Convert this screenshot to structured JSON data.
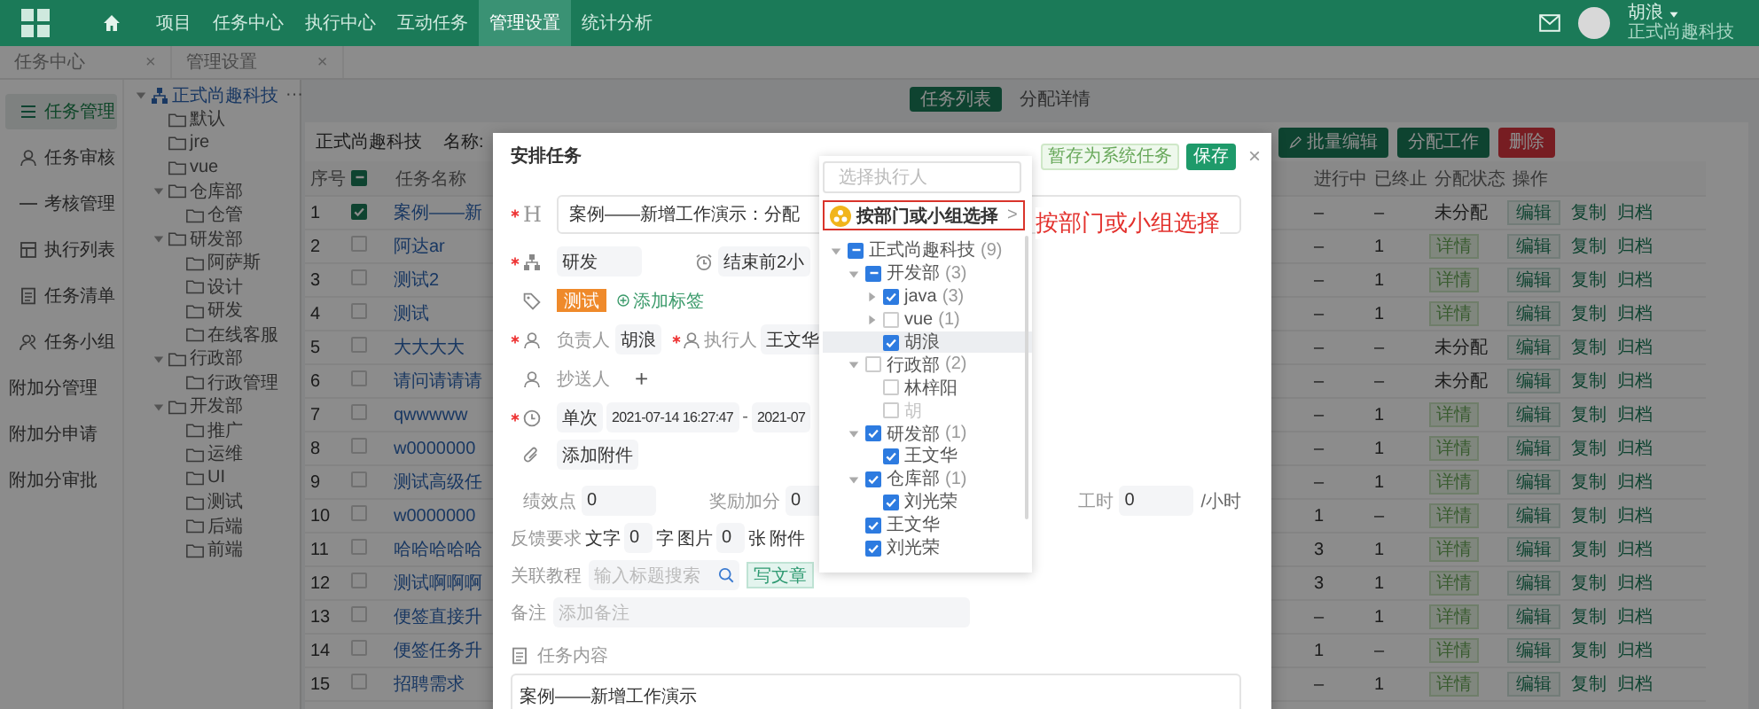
{
  "top_nav": {
    "items": [
      {
        "label": "项目",
        "selected": false
      },
      {
        "label": "任务中心",
        "selected": false
      },
      {
        "label": "执行中心",
        "selected": false
      },
      {
        "label": "互动任务",
        "selected": false
      },
      {
        "label": "管理设置",
        "selected": true
      },
      {
        "label": "统计分析",
        "selected": false
      }
    ],
    "user": {
      "name": "胡浪",
      "org": "正式尚趣科技"
    }
  },
  "page_tabs": [
    {
      "label": "任务中心",
      "close": "×"
    },
    {
      "label": "管理设置",
      "close": "×"
    }
  ],
  "sidebar": {
    "items": [
      {
        "label": "任务管理",
        "selected": true
      },
      {
        "label": "任务审核",
        "selected": false
      },
      {
        "label": "考核管理",
        "selected": false
      },
      {
        "label": "执行列表",
        "selected": false
      },
      {
        "label": "任务清单",
        "selected": false
      },
      {
        "label": "任务小组",
        "selected": false
      },
      {
        "label": "附加分管理",
        "selected": false
      },
      {
        "label": "附加分申请",
        "selected": false
      },
      {
        "label": "附加分审批",
        "selected": false
      }
    ]
  },
  "org_tree": {
    "label": "正式尚趣科技",
    "more": "···",
    "expanded": true,
    "children": [
      {
        "label": "默认"
      },
      {
        "label": "jre"
      },
      {
        "label": "vue"
      },
      {
        "label": "仓库部",
        "expanded": true,
        "children": [
          {
            "label": "仓管"
          }
        ]
      },
      {
        "label": "研发部",
        "expanded": true,
        "children": [
          {
            "label": "阿萨斯"
          },
          {
            "label": "设计"
          },
          {
            "label": "研发"
          },
          {
            "label": "在线客服"
          }
        ]
      },
      {
        "label": "行政部",
        "expanded": true,
        "children": [
          {
            "label": "行政管理"
          }
        ]
      },
      {
        "label": "开发部",
        "expanded": true,
        "children": [
          {
            "label": "推广"
          },
          {
            "label": "运维"
          },
          {
            "label": "UI"
          },
          {
            "label": "测试"
          },
          {
            "label": "后端"
          },
          {
            "label": "前端"
          }
        ]
      }
    ]
  },
  "main": {
    "view_tabs": [
      {
        "label": "任务列表",
        "selected": true
      },
      {
        "label": "分配详情",
        "selected": false
      }
    ],
    "org": "正式尚趣科技",
    "name_label": "名称:",
    "buttons": [
      {
        "label": "批量编辑",
        "kind": "primary"
      },
      {
        "label": "分配工作",
        "kind": "primary"
      },
      {
        "label": "删除",
        "kind": "danger"
      }
    ],
    "table": {
      "columns": [
        "序号",
        "任务名称",
        "进行中",
        "已终止",
        "分配状态",
        "操作"
      ],
      "header_checked": false,
      "header_indeterminate": true,
      "rows": [
        {
          "no": "1",
          "selected": true,
          "name": "案例——新",
          "in_progress": "–",
          "terminated": "–",
          "status": {
            "kind": "text",
            "label": "未分配"
          },
          "edit": "编辑",
          "copy": "复制",
          "archive": "归档"
        },
        {
          "no": "2",
          "selected": false,
          "name": "阿达ar",
          "in_progress": "–",
          "terminated": "1",
          "status": {
            "kind": "button",
            "label": "详情"
          },
          "edit": "编辑",
          "copy": "复制",
          "archive": "归档"
        },
        {
          "no": "3",
          "selected": false,
          "name": "测试2",
          "in_progress": "–",
          "terminated": "1",
          "status": {
            "kind": "button",
            "label": "详情"
          },
          "edit": "编辑",
          "copy": "复制",
          "archive": "归档"
        },
        {
          "no": "4",
          "selected": false,
          "name": "测试",
          "in_progress": "–",
          "terminated": "1",
          "status": {
            "kind": "button",
            "label": "详情"
          },
          "edit": "编辑",
          "copy": "复制",
          "archive": "归档"
        },
        {
          "no": "5",
          "selected": false,
          "name": "大大大大",
          "in_progress": "–",
          "terminated": "–",
          "status": {
            "kind": "text",
            "label": "未分配"
          },
          "edit": "编辑",
          "copy": "复制",
          "archive": "归档"
        },
        {
          "no": "6",
          "selected": false,
          "name": "请问请请请",
          "in_progress": "–",
          "terminated": "–",
          "status": {
            "kind": "text",
            "label": "未分配"
          },
          "edit": "编辑",
          "copy": "复制",
          "archive": "归档"
        },
        {
          "no": "7",
          "selected": false,
          "name": "qwwwww",
          "in_progress": "–",
          "terminated": "1",
          "status": {
            "kind": "button",
            "label": "详情"
          },
          "edit": "编辑",
          "copy": "复制",
          "archive": "归档"
        },
        {
          "no": "8",
          "selected": false,
          "name": "w0000000",
          "in_progress": "–",
          "terminated": "1",
          "status": {
            "kind": "button",
            "label": "详情"
          },
          "edit": "编辑",
          "copy": "复制",
          "archive": "归档"
        },
        {
          "no": "9",
          "selected": false,
          "name": "测试高级任",
          "in_progress": "–",
          "terminated": "1",
          "status": {
            "kind": "button",
            "label": "详情"
          },
          "edit": "编辑",
          "copy": "复制",
          "archive": "归档"
        },
        {
          "no": "10",
          "selected": false,
          "name": "w0000000",
          "in_progress": "1",
          "terminated": "–",
          "status": {
            "kind": "button",
            "label": "详情"
          },
          "edit": "编辑",
          "copy": "复制",
          "archive": "归档"
        },
        {
          "no": "11",
          "selected": false,
          "name": "哈哈哈哈哈",
          "in_progress": "3",
          "terminated": "1",
          "status": {
            "kind": "button",
            "label": "详情"
          },
          "edit": "编辑",
          "copy": "复制",
          "archive": "归档"
        },
        {
          "no": "12",
          "selected": false,
          "name": "测试啊啊啊",
          "in_progress": "3",
          "terminated": "1",
          "status": {
            "kind": "button",
            "label": "详情"
          },
          "edit": "编辑",
          "copy": "复制",
          "archive": "归档"
        },
        {
          "no": "13",
          "selected": false,
          "name": "便签直接升",
          "in_progress": "–",
          "terminated": "1",
          "status": {
            "kind": "button",
            "label": "详情"
          },
          "edit": "编辑",
          "copy": "复制",
          "archive": "归档"
        },
        {
          "no": "14",
          "selected": false,
          "name": "便签任务升",
          "in_progress": "1",
          "terminated": "–",
          "status": {
            "kind": "button",
            "label": "详情"
          },
          "edit": "编辑",
          "copy": "复制",
          "archive": "归档"
        },
        {
          "no": "15",
          "selected": false,
          "name": "招聘需求",
          "in_progress": "–",
          "terminated": "1",
          "status": {
            "kind": "button",
            "label": "详情"
          },
          "edit": "编辑",
          "copy": "复制",
          "archive": "归档"
        }
      ]
    }
  },
  "dialog": {
    "title": "安排任务",
    "buttons": [
      {
        "label": "暂存为系统任务",
        "kind": "secondary"
      },
      {
        "label": "保存",
        "kind": "primary"
      }
    ],
    "close": "×",
    "title_icon": "H",
    "title_value": "案例——新增工作演示：分配",
    "department": "研发",
    "reminder": "结束前2小",
    "tags": [
      {
        "label": "测试",
        "color": "#ef8a2b"
      }
    ],
    "add_tag": "添加标签",
    "owner": {
      "label": "负责人",
      "value": "胡浪"
    },
    "executor": {
      "label": "执行人",
      "value": "王文华"
    },
    "cc": {
      "label": "抄送人",
      "add": "+"
    },
    "time": {
      "mode": "单次",
      "start": "2021-07-14 16:27:47",
      "separator": "-",
      "end": "2021-07"
    },
    "attachment": "添加附件",
    "performance": {
      "label": "绩效点",
      "value": "0"
    },
    "bonus": {
      "label": "奖励加分",
      "value": "0"
    },
    "hours": {
      "label": "工时",
      "value": "0",
      "unit": "/小时"
    },
    "feedback": {
      "label": "反馈要求",
      "text_label": "文字",
      "text_value": "0",
      "text_unit": "字",
      "image_label": "图片",
      "image_value": "0",
      "image_unit": "张",
      "attach_label": "附件"
    },
    "tutorial": {
      "label": "关联教程",
      "placeholder": "输入标题搜索",
      "write": "写文章"
    },
    "remark": {
      "label": "备注",
      "placeholder": "添加备注"
    },
    "content": {
      "label": "任务内容",
      "value": "案例——新增工作演示"
    }
  },
  "picker": {
    "placeholder": "选择执行人",
    "group_select": "按部门或小组选择",
    "chevron": ">",
    "tree": [
      {
        "label": "正式尚趣科技",
        "count": "(9)",
        "checked": false,
        "indeterminate": true,
        "disabled": false,
        "highlighted": false,
        "expanded": true,
        "children": [
          {
            "label": "开发部",
            "count": "(3)",
            "checked": false,
            "indeterminate": true,
            "disabled": false,
            "highlighted": false,
            "expanded": true,
            "children": [
              {
                "label": "java",
                "count": "(3)",
                "checked": true,
                "indeterminate": false,
                "disabled": false,
                "highlighted": false,
                "expanded": false
              },
              {
                "label": "vue",
                "count": "(1)",
                "checked": false,
                "indeterminate": false,
                "disabled": false,
                "highlighted": false,
                "expanded": false
              },
              {
                "label": "胡浪",
                "checked": true,
                "indeterminate": false,
                "disabled": false,
                "highlighted": true
              }
            ]
          },
          {
            "label": "行政部",
            "count": "(2)",
            "checked": false,
            "indeterminate": false,
            "disabled": false,
            "highlighted": false,
            "expanded": true,
            "children": [
              {
                "label": "林梓阳",
                "checked": false,
                "indeterminate": false,
                "disabled": false,
                "highlighted": false
              },
              {
                "label": "胡",
                "checked": false,
                "indeterminate": false,
                "disabled": true,
                "highlighted": false
              }
            ]
          },
          {
            "label": "研发部",
            "count": "(1)",
            "checked": true,
            "indeterminate": false,
            "disabled": false,
            "highlighted": false,
            "expanded": true,
            "children": [
              {
                "label": "王文华",
                "checked": true,
                "indeterminate": false,
                "disabled": false,
                "highlighted": false
              }
            ]
          },
          {
            "label": "仓库部",
            "count": "(1)",
            "checked": true,
            "indeterminate": false,
            "disabled": false,
            "highlighted": false,
            "expanded": true,
            "children": [
              {
                "label": "刘光荣",
                "checked": true,
                "indeterminate": false,
                "disabled": false,
                "highlighted": false
              }
            ]
          },
          {
            "label": "王文华",
            "checked": true,
            "indeterminate": false,
            "disabled": false,
            "highlighted": false
          },
          {
            "label": "刘光荣",
            "checked": true,
            "indeterminate": false,
            "disabled": false,
            "highlighted": false
          }
        ]
      }
    ]
  },
  "annotation": "按部门或小组选择"
}
